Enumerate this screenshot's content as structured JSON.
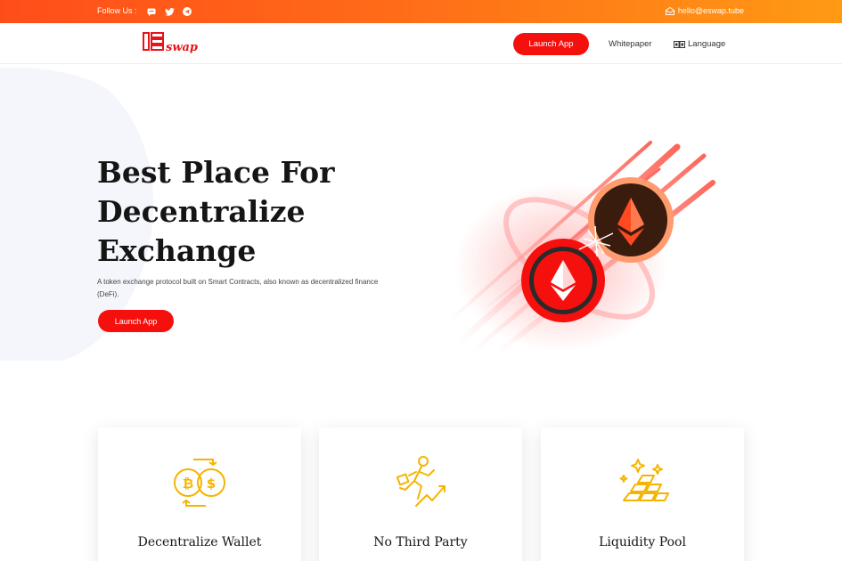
{
  "topbar": {
    "follow_label": "Follow Us :",
    "social_icons": [
      "chat-icon",
      "twitter-icon",
      "telegram-icon"
    ],
    "email": "hello@eswap.tube"
  },
  "nav": {
    "logo_text": "swap",
    "launch_label": "Launch App",
    "whitepaper_label": "Whitepaper",
    "language_label": "Language"
  },
  "hero": {
    "title_line1": "Best Place For",
    "title_line2": "Decentralize",
    "title_line3": "Exchange",
    "description": "A token exchange protocol built on Smart Contracts, also known as decentralized finance (DeFi).",
    "launch_label": "Launch App"
  },
  "features": [
    {
      "title": "Decentralize Wallet",
      "icon": "crypto-exchange-icon"
    },
    {
      "title": "No Third Party",
      "icon": "growth-person-icon"
    },
    {
      "title": "Liquidity Pool",
      "icon": "gold-bars-icon"
    }
  ],
  "colors": {
    "accent": "#f5100e",
    "topbar_start": "#ff4d1a",
    "topbar_end": "#ff9a14",
    "icon_gold": "#f5b400"
  }
}
